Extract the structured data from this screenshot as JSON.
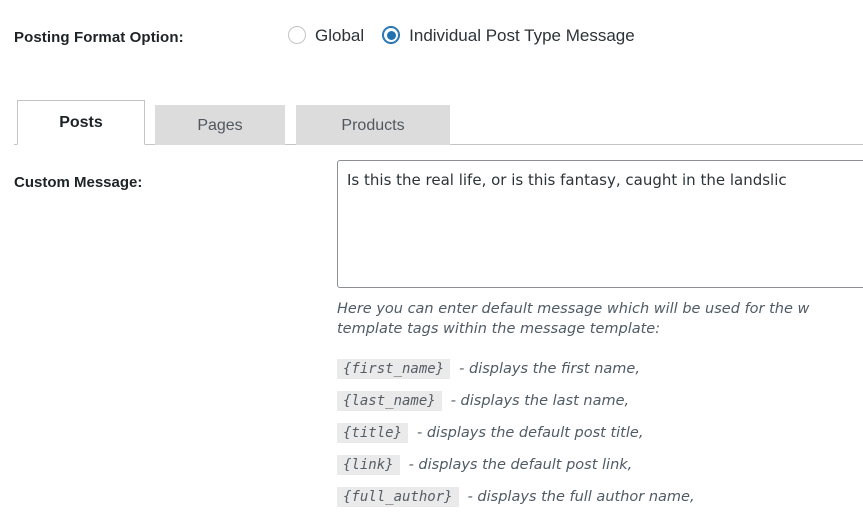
{
  "form": {
    "posting_format": {
      "label": "Posting Format Option:",
      "options": [
        {
          "label": "Global",
          "selected": false
        },
        {
          "label": "Individual Post Type Message",
          "selected": true
        }
      ]
    },
    "tabs": [
      {
        "label": "Posts",
        "active": true
      },
      {
        "label": "Pages",
        "active": false
      },
      {
        "label": "Products",
        "active": false
      }
    ],
    "custom_message": {
      "label": "Custom Message:",
      "value": "Is this the real life, or is this fantasy, caught in the landslic",
      "placeholder": ""
    },
    "help_text": "Here you can enter default message which will be used for the w\ntemplate tags within the message template:",
    "template_tags": [
      {
        "tag": "{first_name}",
        "description": "- displays the first name,"
      },
      {
        "tag": "{last_name}",
        "description": "- displays the last name,"
      },
      {
        "tag": "{title}",
        "description": "- displays the default post title,"
      },
      {
        "tag": "{link}",
        "description": "- displays the default post link,"
      },
      {
        "tag": "{full_author}",
        "description": "- displays the full author name,"
      }
    ]
  },
  "colors": {
    "accent": "#2271b1",
    "tab_inactive_bg": "#dcdcdc",
    "border": "#c3c4c7",
    "code_bg": "#eaeaea",
    "help_text": "#4f5b66"
  }
}
